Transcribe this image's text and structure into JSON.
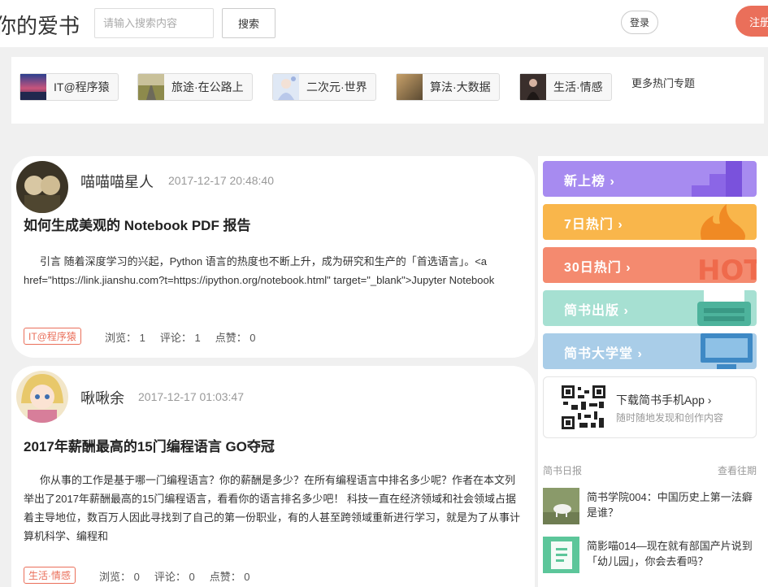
{
  "header": {
    "brand": "你的爱书",
    "search_placeholder": "请输入搜索内容",
    "search_button": "搜索",
    "login_button": "登录",
    "register_button": "注册"
  },
  "topics": {
    "items": [
      {
        "label": "IT@程序猿"
      },
      {
        "label": "旅途·在公路上"
      },
      {
        "label": "二次元·世界"
      },
      {
        "label": "算法·大数据"
      },
      {
        "label": "生活·情感"
      }
    ],
    "more": "更多热门专题"
  },
  "articles": [
    {
      "author": "喵喵喵星人",
      "time": "2017-12-17 20:48:40",
      "title": "如何生成美观的 Notebook PDF 报告",
      "body": "引言 随着深度学习的兴起，Python 语言的热度也不断上升，成为研究和生产的「首选语言」。<a href=\"https://link.jianshu.com?t=https://ipython.org/notebook.html\" target=\"_blank\">Jupyter Notebook",
      "tag": "IT@程序猿",
      "views": "浏览： 1",
      "comments": "评论： 1",
      "likes": "点赞： 0"
    },
    {
      "author": "啾啾余",
      "time": "2017-12-17 01:03:47",
      "title": "2017年薪酬最高的15门编程语言 GO夺冠",
      "body": "你从事的工作是基于哪一门编程语言？你的薪酬是多少？在所有编程语言中排名多少呢？作者在本文列举出了2017年薪酬最高的15门编程语言，看看你的语言排名多少吧！ 科技一直在经济领域和社会领域占据着主导地位，数百万人因此寻找到了自己的第一份职业，有的人甚至跨领域重新进行学习，就是为了从事计算机科学、编程和",
      "tag": "生活·情感",
      "views": "浏览： 0",
      "comments": "评论： 0",
      "likes": "点赞： 0"
    }
  ],
  "sidebar": {
    "rankings": [
      {
        "label": "新上榜 ›",
        "color": "#a78bf0"
      },
      {
        "label": "7日热门 ›",
        "color": "#f9b64b"
      },
      {
        "label": "30日热门 ›",
        "color": "#f48a6f"
      },
      {
        "label": "简书出版 ›",
        "color": "#a6e0d2"
      },
      {
        "label": "简书大学堂 ›",
        "color": "#a9cde8"
      }
    ],
    "app": {
      "title": "下载简书手机App ›",
      "subtitle": "随时随地发现和创作内容"
    },
    "daily": {
      "heading": "简书日报",
      "more": "查看往期",
      "items": [
        {
          "text": "简书学院004：中国历史上第一法癖是谁？"
        },
        {
          "text": "简影喵014—现在就有部国产片说到「幼儿园」，你会去看吗？"
        }
      ]
    }
  }
}
